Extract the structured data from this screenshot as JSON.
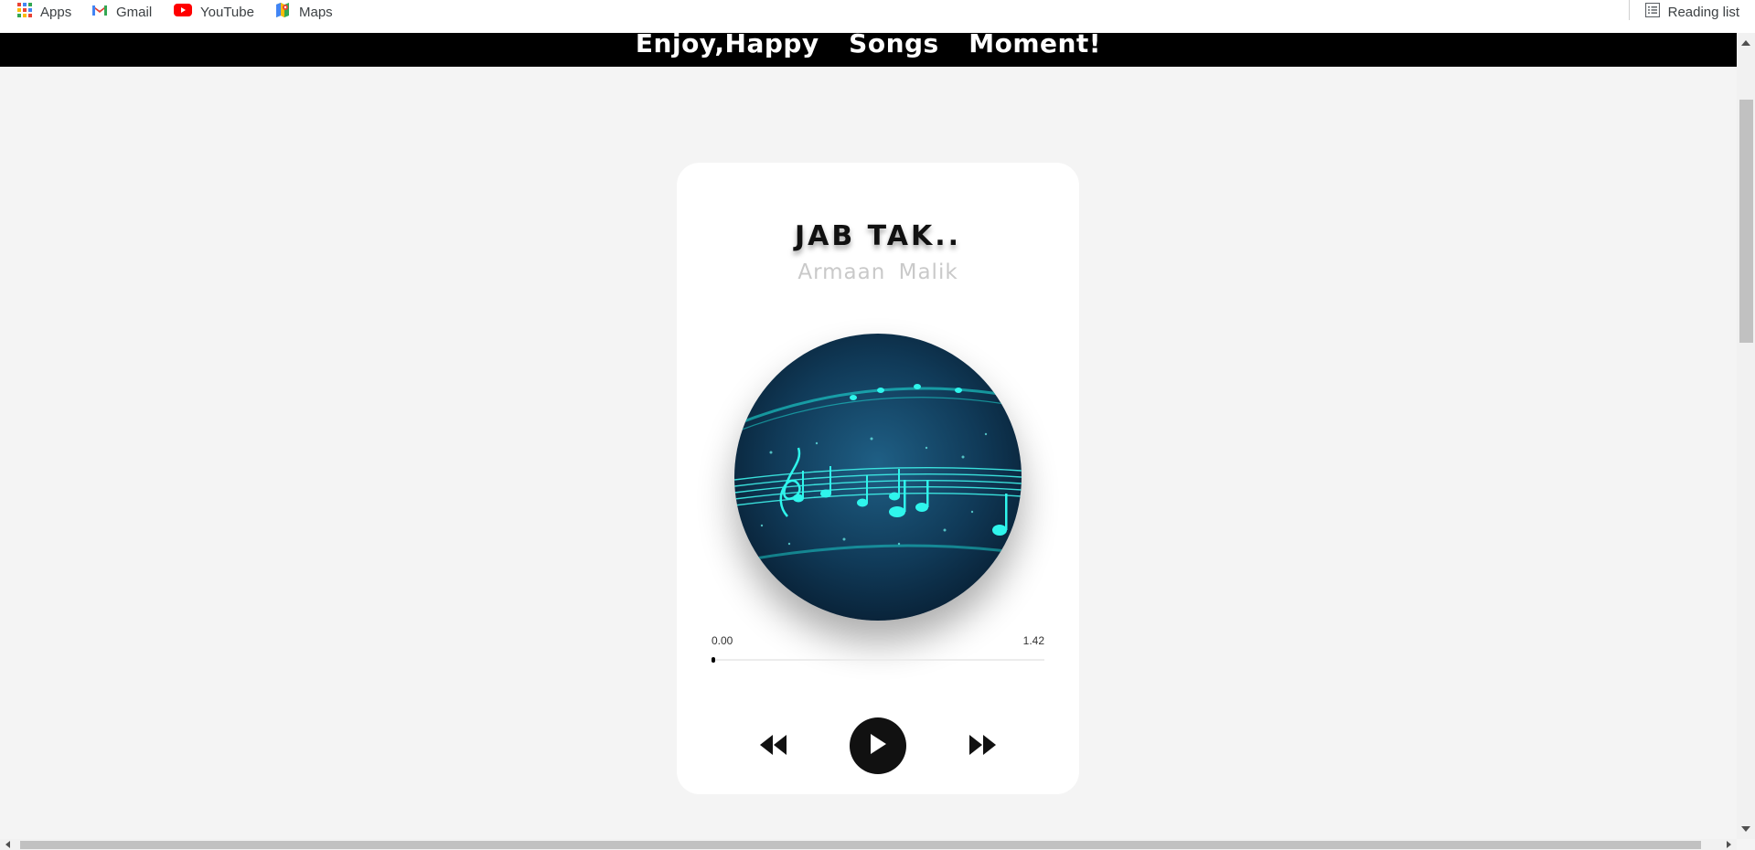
{
  "bookmarks": {
    "items": [
      {
        "label": "Apps",
        "icon": "apps-grid-icon"
      },
      {
        "label": "Gmail",
        "icon": "gmail-icon"
      },
      {
        "label": "YouTube",
        "icon": "youtube-icon"
      },
      {
        "label": "Maps",
        "icon": "maps-icon"
      }
    ],
    "reading_list": {
      "label": "Reading list",
      "icon": "reading-list-icon"
    }
  },
  "header": {
    "title": "Enjoy,Happy  Songs  Moment!"
  },
  "player": {
    "song_title": "JAB TAK..",
    "artist": "Armaan Malik",
    "time_current": "0.00",
    "time_duration": "1.42",
    "progress_fraction": 0.0,
    "controls": {
      "prev_icon": "backward-icon",
      "play_icon": "play-icon",
      "next_icon": "forward-icon"
    }
  },
  "colors": {
    "banner_bg": "#000000",
    "banner_text": "#ffffff",
    "page_bg": "#f4f4f4",
    "card_bg": "#ffffff",
    "artist_text": "#c9c9c9",
    "play_button_bg": "#111111",
    "artwork_glow": "#1de9e0"
  }
}
